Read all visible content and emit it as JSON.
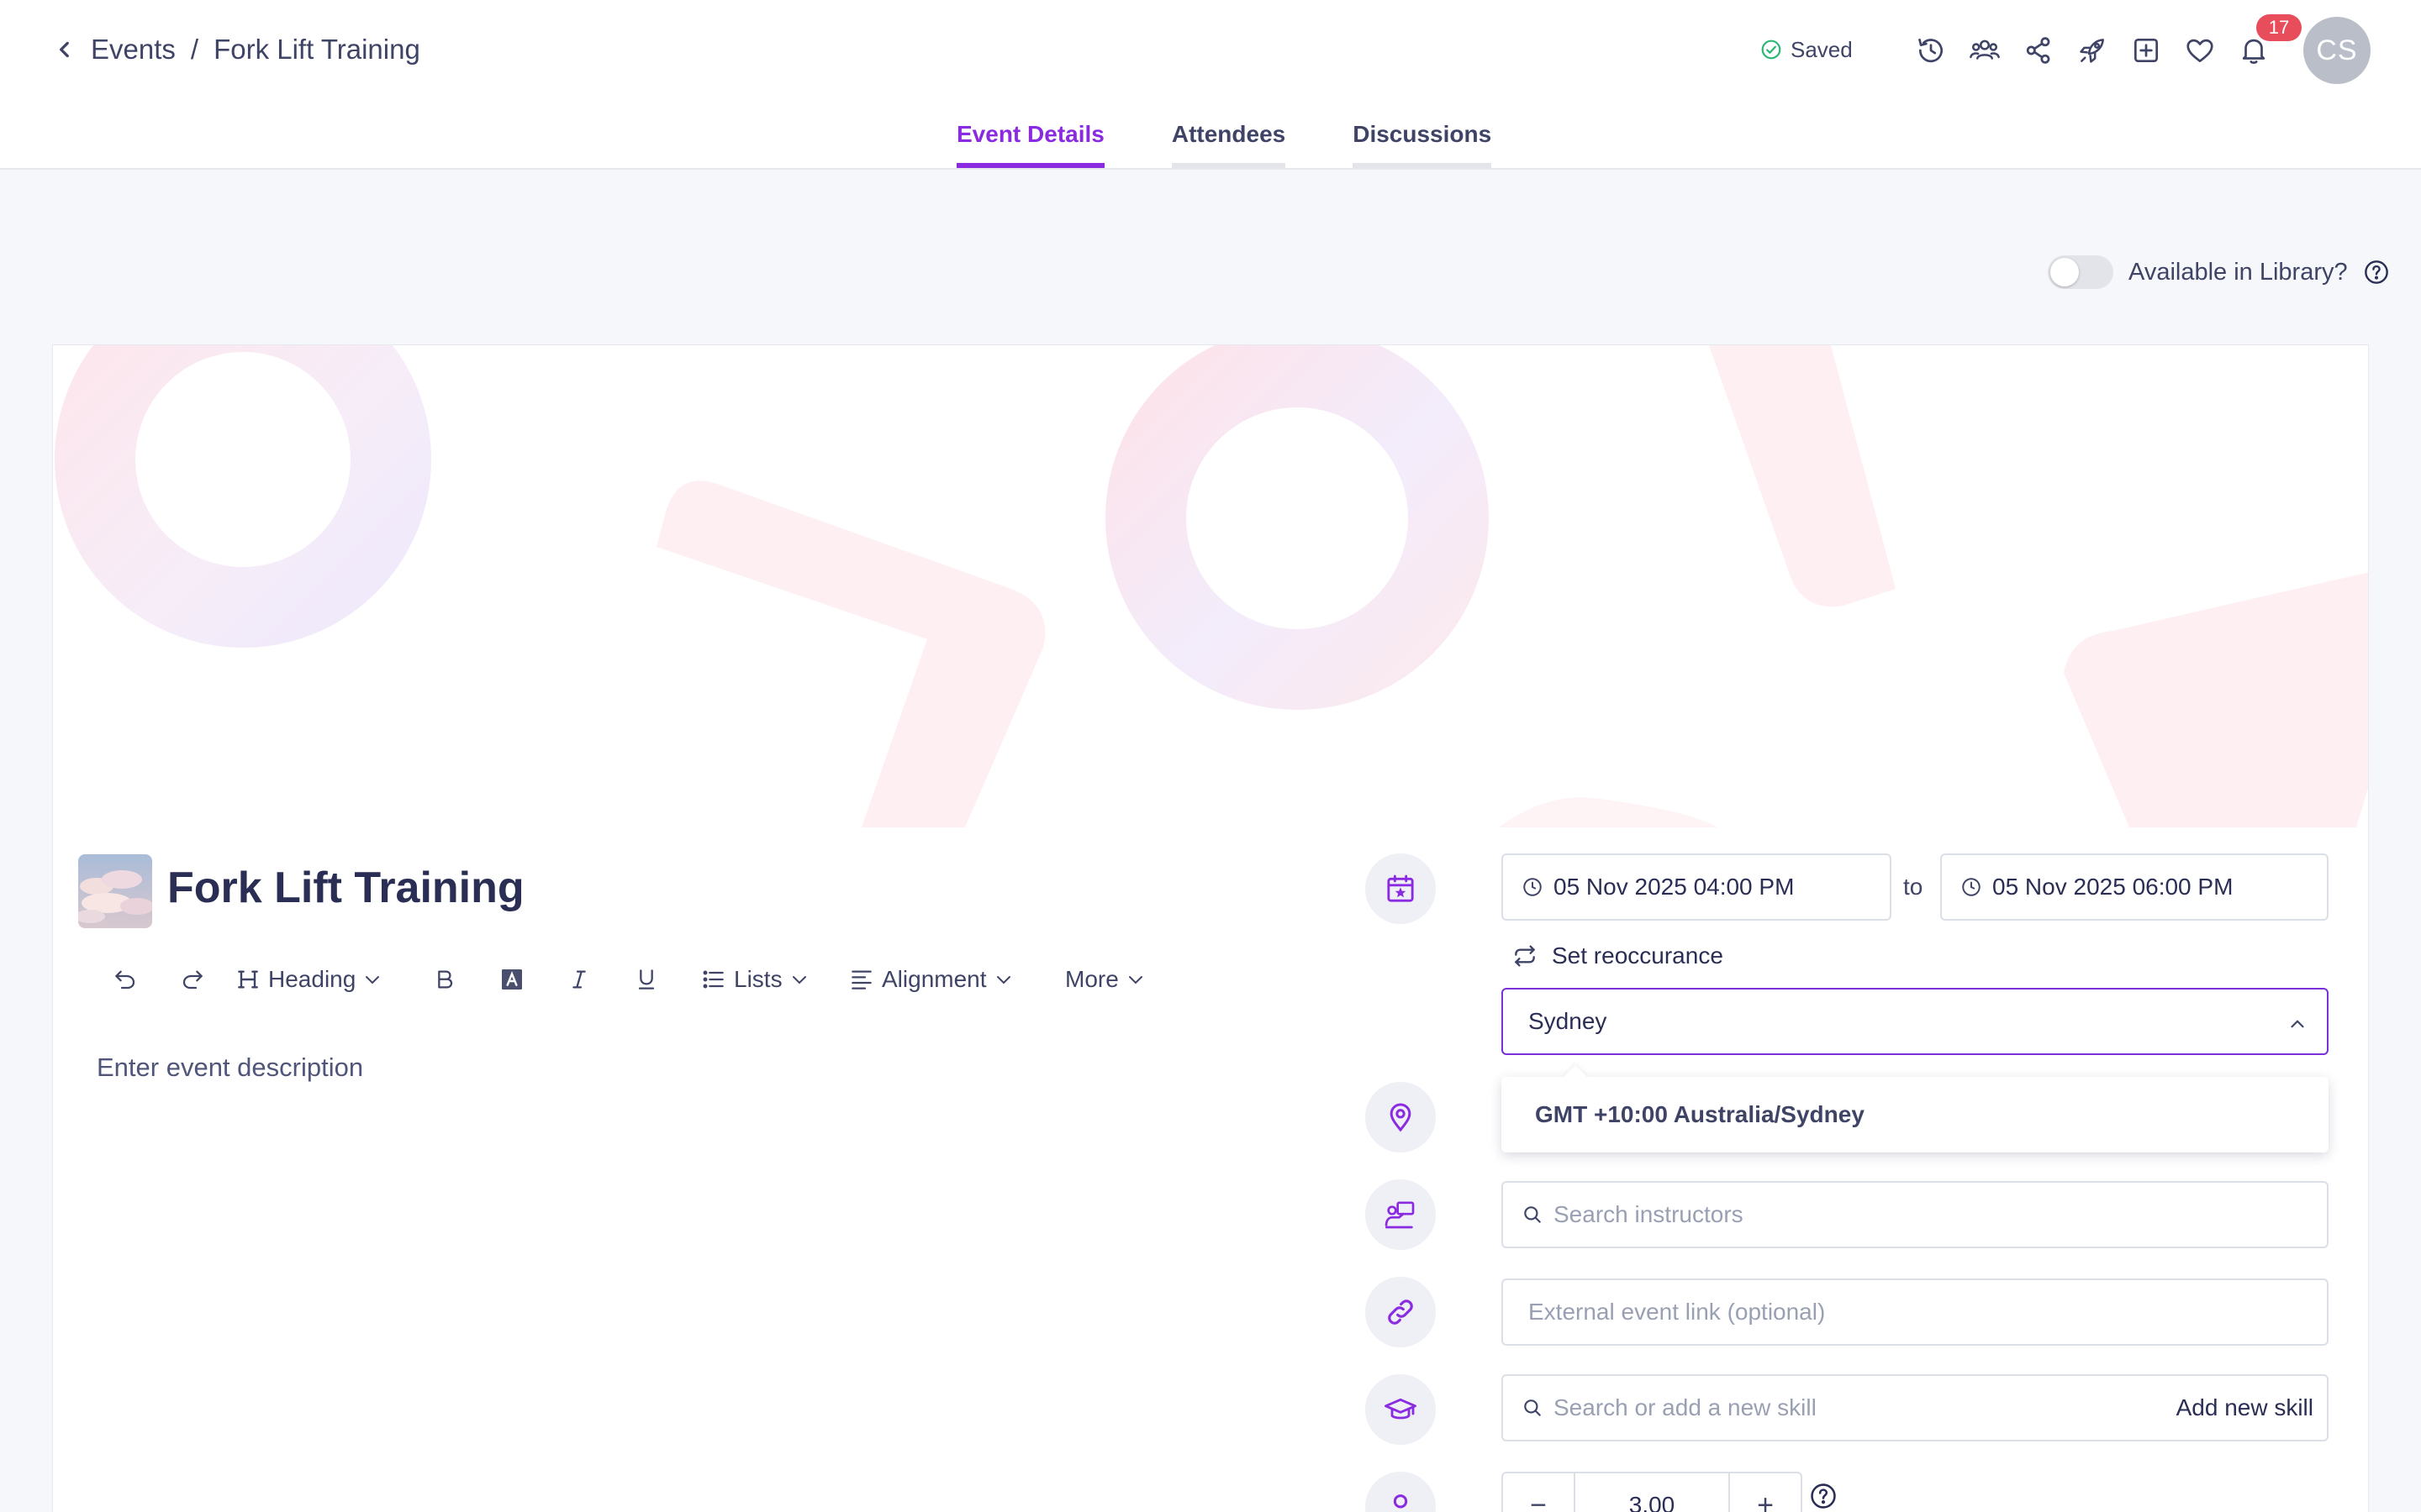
{
  "breadcrumb": {
    "parent": "Events",
    "separator": "/",
    "current": "Fork Lift Training"
  },
  "status": {
    "saved_label": "Saved",
    "saved_color": "#2bb673"
  },
  "toolbar": {
    "icons": [
      "history-icon",
      "users-icon",
      "share-icon",
      "rocket-icon",
      "add-square-icon",
      "heart-icon",
      "bell-icon"
    ],
    "notification_count": "17"
  },
  "user": {
    "initials": "CS"
  },
  "tabs": [
    {
      "label": "Event Details",
      "active": true
    },
    {
      "label": "Attendees",
      "active": false
    },
    {
      "label": "Discussions",
      "active": false
    }
  ],
  "library": {
    "label": "Available in Library?",
    "enabled": false
  },
  "event": {
    "title": "Fork Lift Training",
    "description_placeholder": "Enter event description"
  },
  "editor_toolbar": {
    "heading": "Heading",
    "lists": "Lists",
    "alignment": "Alignment",
    "more": "More"
  },
  "schedule": {
    "start": "05 Nov 2025 04:00 PM",
    "to_label": "to",
    "end": "05 Nov 2025 06:00 PM",
    "reoccurrence_label": "Set reoccurance"
  },
  "timezone": {
    "search_value": "Sydney",
    "options": [
      "GMT +10:00 Australia/Sydney"
    ]
  },
  "instructors": {
    "placeholder": "Search instructors"
  },
  "external_link": {
    "placeholder": "External event link (optional)"
  },
  "skills": {
    "placeholder": "Search or add a new skill",
    "add_label": "Add new skill"
  },
  "points": {
    "value": "3.00",
    "minus": "−",
    "plus": "+"
  },
  "colors": {
    "accent": "#8a2be2",
    "text": "#2b2e54",
    "muted": "#9aa0b3",
    "badge": "#e84d5b"
  }
}
